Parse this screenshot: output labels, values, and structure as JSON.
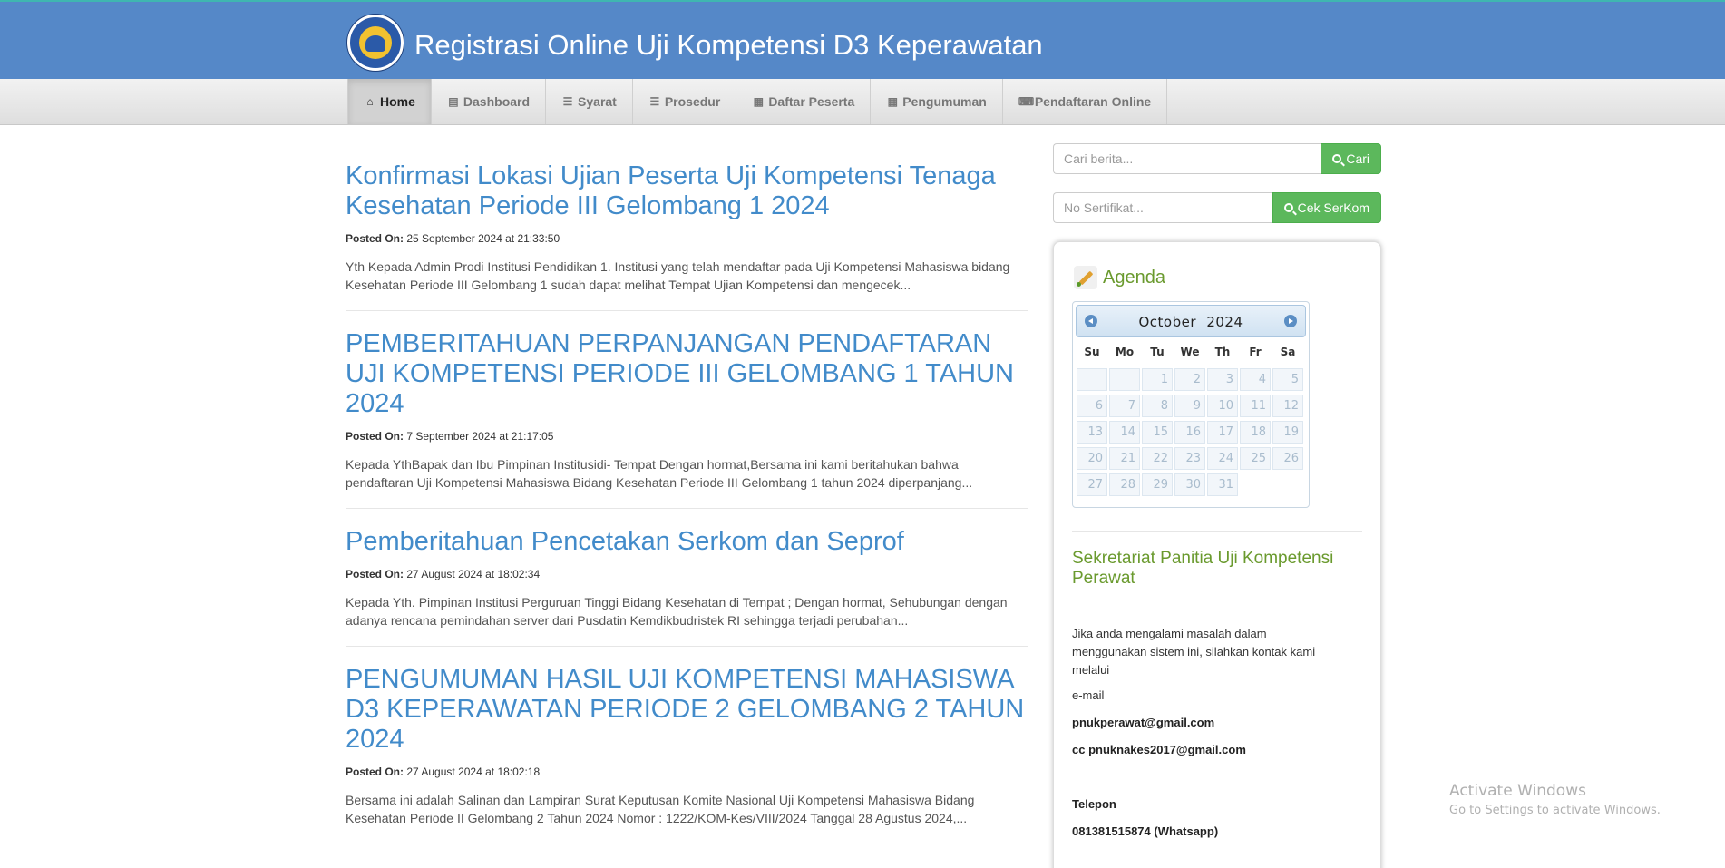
{
  "header": {
    "title": "Registrasi Online Uji Kompetensi D3 Keperawatan",
    "logo_icon": "tut-wuri-handayani-logo"
  },
  "nav": [
    {
      "label": "Home",
      "icon": "home-icon",
      "glyph": "⌂",
      "active": true
    },
    {
      "label": "Dashboard",
      "icon": "book-icon",
      "glyph": "▤"
    },
    {
      "label": "Syarat",
      "icon": "list-icon",
      "glyph": "☰"
    },
    {
      "label": "Prosedur",
      "icon": "list-icon",
      "glyph": "☰"
    },
    {
      "label": "Daftar Peserta",
      "icon": "table-icon",
      "glyph": "▦"
    },
    {
      "label": "Pengumuman",
      "icon": "table-icon",
      "glyph": "▦"
    },
    {
      "label": "Pendaftaran Online",
      "icon": "keyboard-icon",
      "glyph": "⌨"
    }
  ],
  "posts": [
    {
      "title": "Konfirmasi Lokasi Ujian Peserta Uji Kompetensi Tenaga Kesehatan Periode III Gelombang 1 2024",
      "meta_label": "Posted On:",
      "date": "25 September 2024 at 21:33:50",
      "excerpt": "Yth Kepada Admin Prodi Institusi Pendidikan 1. Institusi yang telah mendaftar pada Uji Kompetensi Mahasiswa bidang Kesehatan Periode III Gelombang 1 sudah dapat melihat Tempat Ujian Kompetensi dan mengecek..."
    },
    {
      "title": "PEMBERITAHUAN PERPANJANGAN PENDAFTARAN UJI KOMPETENSI PERIODE III GELOMBANG 1 TAHUN 2024",
      "meta_label": "Posted On:",
      "date": "7 September 2024 at 21:17:05",
      "excerpt": "Kepada YthBapak dan Ibu Pimpinan Institusidi- Tempat Dengan hormat,Bersama ini kami beritahukan bahwa pendaftaran Uji Kompetensi Mahasiswa Bidang Kesehatan Periode III Gelombang 1 tahun 2024 diperpanjang..."
    },
    {
      "title": "Pemberitahuan Pencetakan Serkom dan Seprof",
      "meta_label": "Posted On:",
      "date": "27 August 2024 at 18:02:34",
      "excerpt": "Kepada Yth. Pimpinan Institusi Perguruan Tinggi Bidang Kesehatan di Tempat ; Dengan hormat, Sehubungan dengan adanya rencana pemindahan server dari Pusdatin Kemdikbudristek RI sehingga terjadi perubahan..."
    },
    {
      "title": "PENGUMUMAN HASIL UJI KOMPETENSI MAHASISWA D3 KEPERAWATAN PERIODE 2 GELOMBANG 2 TAHUN 2024",
      "meta_label": "Posted On:",
      "date": "27 August 2024 at 18:02:18",
      "excerpt": "Bersama ini adalah Salinan dan Lampiran Surat Keputusan Komite Nasional Uji Kompetensi Mahasiswa Bidang Kesehatan Periode II Gelombang 2 Tahun 2024 Nomor : 1222/KOM-Kes/VIII/2024 Tanggal 28 Agustus 2024,..."
    }
  ],
  "sidebar": {
    "search": {
      "placeholder": "Cari berita...",
      "button": "Cari"
    },
    "certificate": {
      "placeholder": "No Sertifikat...",
      "button": "Cek SerKom"
    },
    "agenda_title": "Agenda",
    "calendar": {
      "month": "October",
      "year": "2024",
      "weekdays": [
        "Su",
        "Mo",
        "Tu",
        "We",
        "Th",
        "Fr",
        "Sa"
      ],
      "leading_blanks": 2,
      "days": [
        "1",
        "2",
        "3",
        "4",
        "5",
        "6",
        "7",
        "8",
        "9",
        "10",
        "11",
        "12",
        "13",
        "14",
        "15",
        "16",
        "17",
        "18",
        "19",
        "20",
        "21",
        "22",
        "23",
        "24",
        "25",
        "26",
        "27",
        "28",
        "29",
        "30",
        "31"
      ]
    },
    "secretariat_title": "Sekretariat Panitia Uji Kompetensi Perawat",
    "contact_intro": "Jika anda mengalami masalah dalam menggunakan sistem ini, silahkan kontak kami melalui",
    "email_label": "e-mail",
    "email_1": "pnukperawat@gmail.com",
    "email_2": "cc pnuknakes2017@gmail.com",
    "phone_label": "Telepon",
    "phone": "081381515874 (Whatsapp)"
  },
  "watermark": {
    "line1": "Activate Windows",
    "line2": "Go to Settings to activate Windows."
  },
  "colors": {
    "header_bg": "#5588c8",
    "link": "#428bca",
    "green_button": "#5cb85c",
    "agenda_green": "#6a9a2e"
  }
}
